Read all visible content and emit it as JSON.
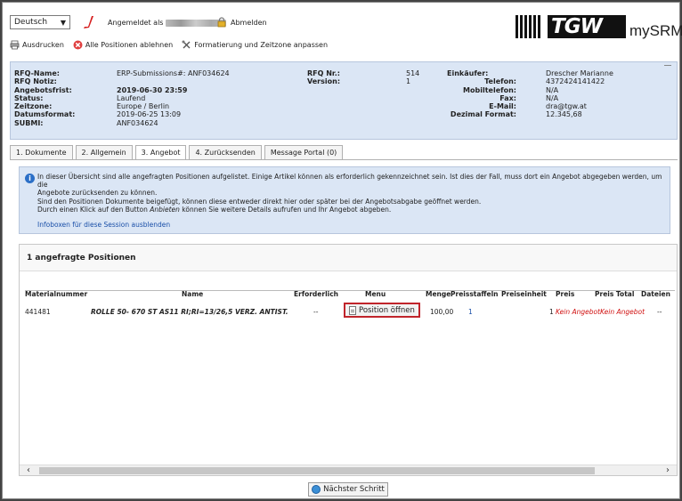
{
  "header": {
    "language": "Deutsch",
    "logged_in_prefix": "Angemeldet als",
    "logout": "Abmelden",
    "brand_letters": "TGW",
    "brand_suffix": "mySRM",
    "toolbar": {
      "print": "Ausdrucken",
      "reject_all": "Alle Positionen ablehnen",
      "format": "Formatierung und Zeitzone anpassen"
    }
  },
  "rfq": {
    "labels_left": [
      "RFQ-Name:",
      "RFQ Notiz:",
      "Angebotsfrist:",
      "Status:",
      "Zeitzone:",
      "Datumsformat:",
      "SUBMI:"
    ],
    "values_left": [
      "ERP-Submissions#: ANF034624",
      "",
      "2019-06-30 23:59",
      "Laufend",
      "Europe / Berlin",
      "2019-06-25 13:09",
      "ANF034624"
    ],
    "labels_mid": [
      "RFQ Nr.:",
      "Version:"
    ],
    "values_mid": [
      "514",
      "1"
    ],
    "labels_right": [
      "Einkäufer:",
      "Telefon:",
      "Mobiltelefon:",
      "Fax:",
      "E-Mail:",
      "Dezimal Format:"
    ],
    "values_right": [
      "Drescher Marianne",
      "4372424141422",
      "N/A",
      "N/A",
      "dra@tgw.at",
      "12.345,68"
    ]
  },
  "tabs": [
    "1. Dokumente",
    "2. Allgemein",
    "3. Angebot",
    "4. Zurücksenden",
    "Message Portal (0)"
  ],
  "infobox": {
    "line1": "In dieser Übersicht sind alle angefragten Positionen aufgelistet. Einige Artikel können als erforderlich gekennzeichnet sein. Ist dies der Fall, muss dort ein Angebot abgegeben werden, um die",
    "line2": "Angebote zurücksenden zu können.",
    "line3": "Sind den Positionen Dokumente beigefügt, können diese entweder direkt hier oder später bei der Angebotsabgabe geöffnet werden.",
    "line4_a": "Durch einen Klick auf den Button ",
    "line4_em": "Anbieten",
    "line4_b": " können Sie weitere Details aufrufen und Ihr Angebot abgeben.",
    "hide_link": "Infoboxen für diese Session ausblenden"
  },
  "positions": {
    "title": "1 angefragte Positionen",
    "columns": [
      "Materialnummer",
      "Name",
      "Erforderlich",
      "Menu",
      "Menge",
      "Preisstaffeln",
      "Preiseinheit",
      "Preis",
      "Preis Total",
      "Dateien"
    ],
    "rows": [
      {
        "material": "441481",
        "name": "ROLLE 50- 670 ST AS11 RI;RI=13/26,5 VERZ. ANTIST.",
        "required": "--",
        "menu_button": "Position öffnen",
        "quantity": "100,00",
        "price_tiers": "1",
        "price_unit": "1",
        "price": "Kein Angebot",
        "price_total": "Kein Angebot",
        "files": "--"
      }
    ]
  },
  "footer": {
    "next_step": "Nächster Schritt"
  }
}
